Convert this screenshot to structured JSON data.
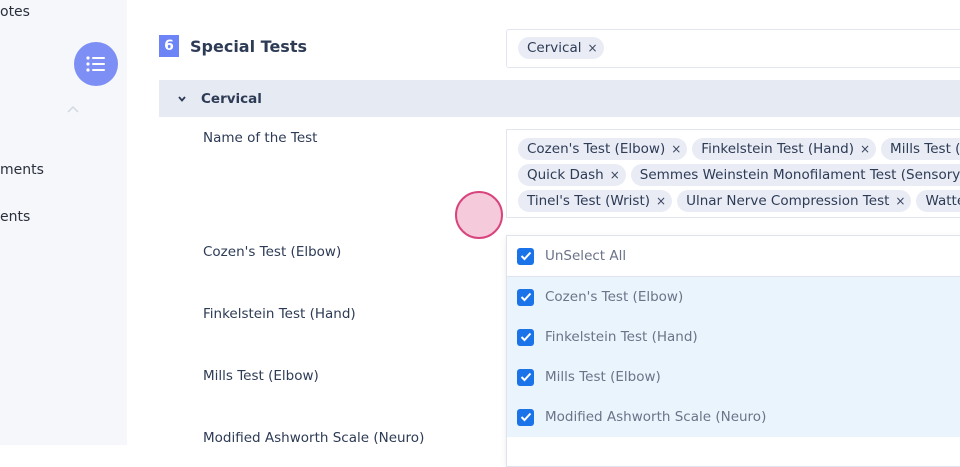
{
  "sidebar": {
    "items": [
      {
        "label": "otes"
      },
      {
        "label": "ments"
      },
      {
        "label": "ents"
      }
    ]
  },
  "section": {
    "number": "6",
    "title": "Special Tests",
    "selected_chips": [
      {
        "label": "Cervical",
        "remove": "×"
      }
    ]
  },
  "group": {
    "label": "Cervical"
  },
  "field": {
    "label": "Name of the Test"
  },
  "tests_chips": {
    "line1": [
      {
        "label": "Cozen's Test (Elbow)",
        "remove": "×"
      },
      {
        "label": "Finkelstein Test (Hand)",
        "remove": "×"
      },
      {
        "label": "Mills Test (Elbow)",
        "remove": "×"
      }
    ],
    "line2": [
      {
        "label": "Quick Dash",
        "remove": "×"
      },
      {
        "label": "Semmes Weinstein Monofilament Test (Sensory)",
        "remove": "×"
      }
    ],
    "line3": [
      {
        "label": "Tinel's Test (Wrist)",
        "remove": "×"
      },
      {
        "label": "Ulnar Nerve Compression Test",
        "remove": "×"
      },
      {
        "label": "Wattenberg",
        "remove": ""
      }
    ]
  },
  "rows": [
    {
      "label": "Cozen's Test (Elbow)"
    },
    {
      "label": "Finkelstein Test (Hand)"
    },
    {
      "label": "Mills Test (Elbow)"
    },
    {
      "label": "Modified Ashworth Scale (Neuro)"
    }
  ],
  "dropdown": {
    "toggle_label": "UnSelect All",
    "options": [
      {
        "label": "Cozen's Test (Elbow)",
        "checked": true
      },
      {
        "label": "Finkelstein Test (Hand)",
        "checked": true
      },
      {
        "label": "Mills Test (Elbow)",
        "checked": true
      },
      {
        "label": "Modified Ashworth Scale (Neuro)",
        "checked": true
      }
    ]
  },
  "colors": {
    "accent": "#6c84f5",
    "checkbox": "#1a73e8",
    "option_bg": "#eaf4fd",
    "group_bg": "#e6eaf3"
  },
  "icons": {
    "fab": "list-icon",
    "sidebar_chevron": "chevron-up-icon",
    "group_chevron": "chevron-down-icon",
    "checkbox": "checkbox-checked-icon"
  }
}
